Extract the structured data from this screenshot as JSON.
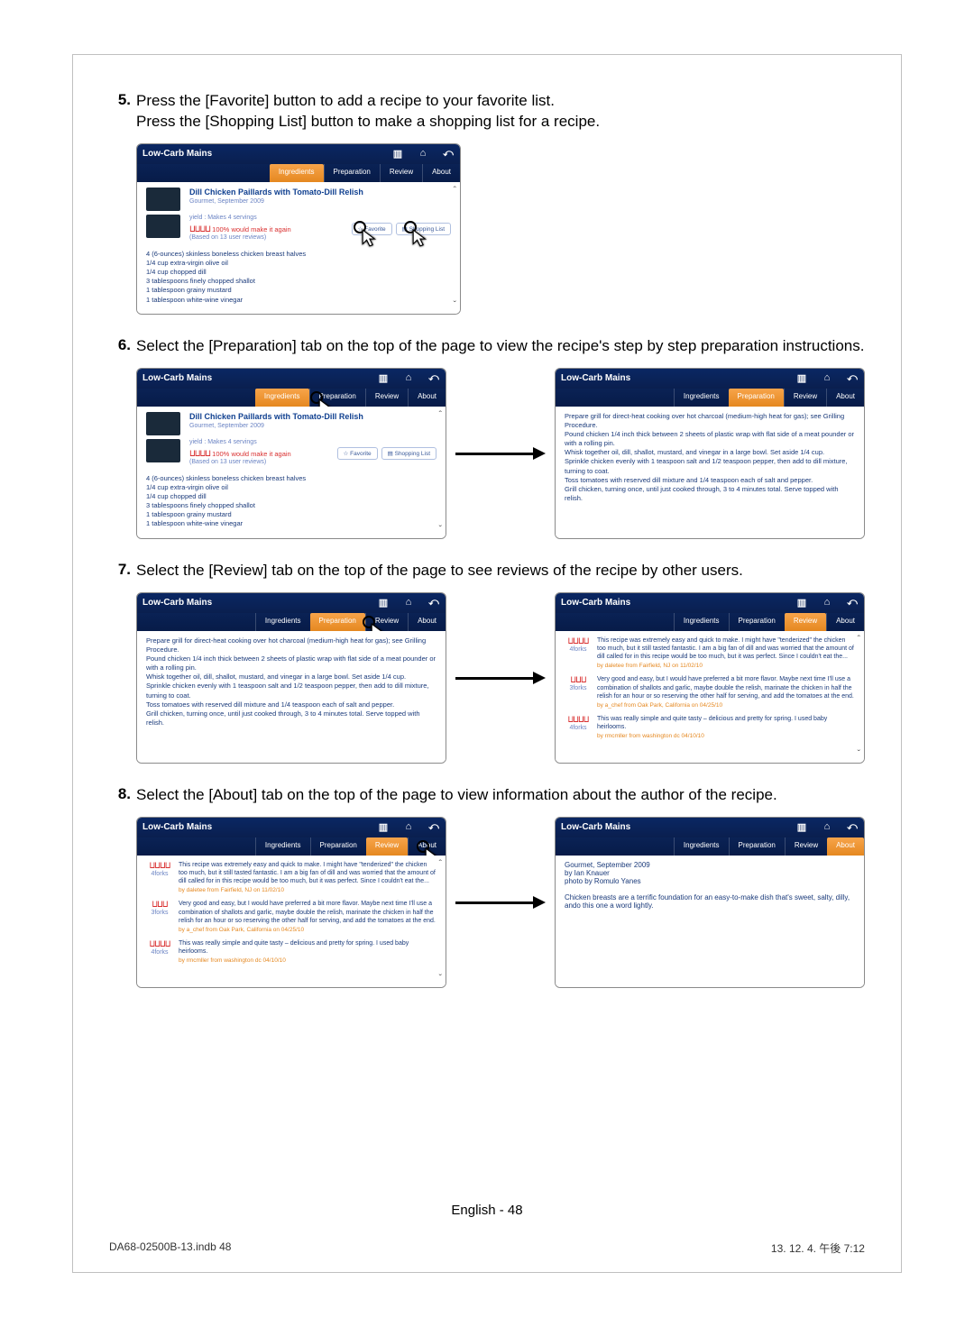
{
  "steps": {
    "5": {
      "num": "5.",
      "text_a": "Press the [Favorite] button to add a recipe to your favorite list.",
      "text_b": "Press the [Shopping List] button to make a shopping list for a recipe."
    },
    "6": {
      "num": "6.",
      "text": "Select the [Preparation] tab on the top of the page to view the recipe's step by step preparation instructions."
    },
    "7": {
      "num": "7.",
      "text": "Select the [Review] tab on the top of the page to see reviews of the recipe by other users."
    },
    "8": {
      "num": "8.",
      "text": "Select the [About] tab on the top of the page to view information about the author of the recipe."
    }
  },
  "app": {
    "title": "Low-Carb Mains",
    "tabs": {
      "ingredients": "Ingredients",
      "preparation": "Preparation",
      "review": "Review",
      "about": "About"
    },
    "recipe": {
      "title": "Dill Chicken Paillards with Tomato-Dill Relish",
      "source": "Gourmet, September 2009",
      "yield": "yield : Makes 4 servings",
      "rating_text": "100% would make it again",
      "rating_sub": "(Based on 13 user reviews)",
      "btn_fav": "Favorite",
      "btn_shop": "Shopping List",
      "ingredients": [
        "4 (6-ounces) skinless boneless chicken breast halves",
        "1/4 cup extra-virgin olive oil",
        "1/4 cup chopped dill",
        "3 tablespoons finely chopped shallot",
        "1 tablespoon grainy mustard",
        "1 tablespoon white-wine vinegar"
      ]
    },
    "preparation": {
      "heading": "Prepare grill for direct-heat cooking over hot charcoal (medium-high heat for gas); see Grilling Procedure.",
      "lines": [
        "Pound chicken 1/4 inch thick between 2 sheets of plastic wrap with flat side of a meat pounder or with a rolling pin.",
        "Whisk together oil, dill, shallot, mustard, and vinegar in a large bowl. Set aside 1/4 cup.",
        "Sprinkle chicken evenly with 1 teaspoon salt and 1/2 teaspoon pepper, then add to dill mixture, turning to coat.",
        "Toss tomatoes with reserved dill mixture and 1/4 teaspoon each of salt and pepper.",
        "Grill chicken, turning once, until just cooked through, 3 to 4 minutes total. Serve topped with relish."
      ]
    },
    "reviews": [
      {
        "forks": "4",
        "text": "This recipe was extremely easy and quick to make. I might have \"tenderized\" the chicken too much, but it still tasted fantastic. I am a big fan of dill and was worried that the amount of dill called for in this recipe would be too much, but it was perfect. Since I couldn't eat the...",
        "by": "by daletee from Fairfield, NJ on 11/02/10"
      },
      {
        "forks": "3",
        "text": "Very good and easy, but I would have preferred a bit more flavor. Maybe next time I'll use a combination of shallots and garlic, maybe double the relish, marinate the chicken in half the relish for an hour or so reserving the other half for serving, and add the tomatoes at the end.",
        "by": "by a_chef from Oak Park, California on 04/25/10"
      },
      {
        "forks": "4",
        "text": "This was really simple and quite tasty – delicious and pretty for spring. I used baby heirlooms.",
        "by": "by rmcmller from washington dc 04/10/10"
      }
    ],
    "about": {
      "source": "Gourmet, September 2009",
      "byline": "by Ian Knauer",
      "photo": "photo by Romulo Yanes",
      "blurb": "Chicken breasts are a terrific foundation for an easy-to-make dish that's sweet, salty, dilly, ando this one a word lightly."
    }
  },
  "footer": {
    "left": "DA68-02500B-13.indb   48",
    "right": "13. 12. 4.   午後 7:12",
    "center": "English - 48"
  }
}
